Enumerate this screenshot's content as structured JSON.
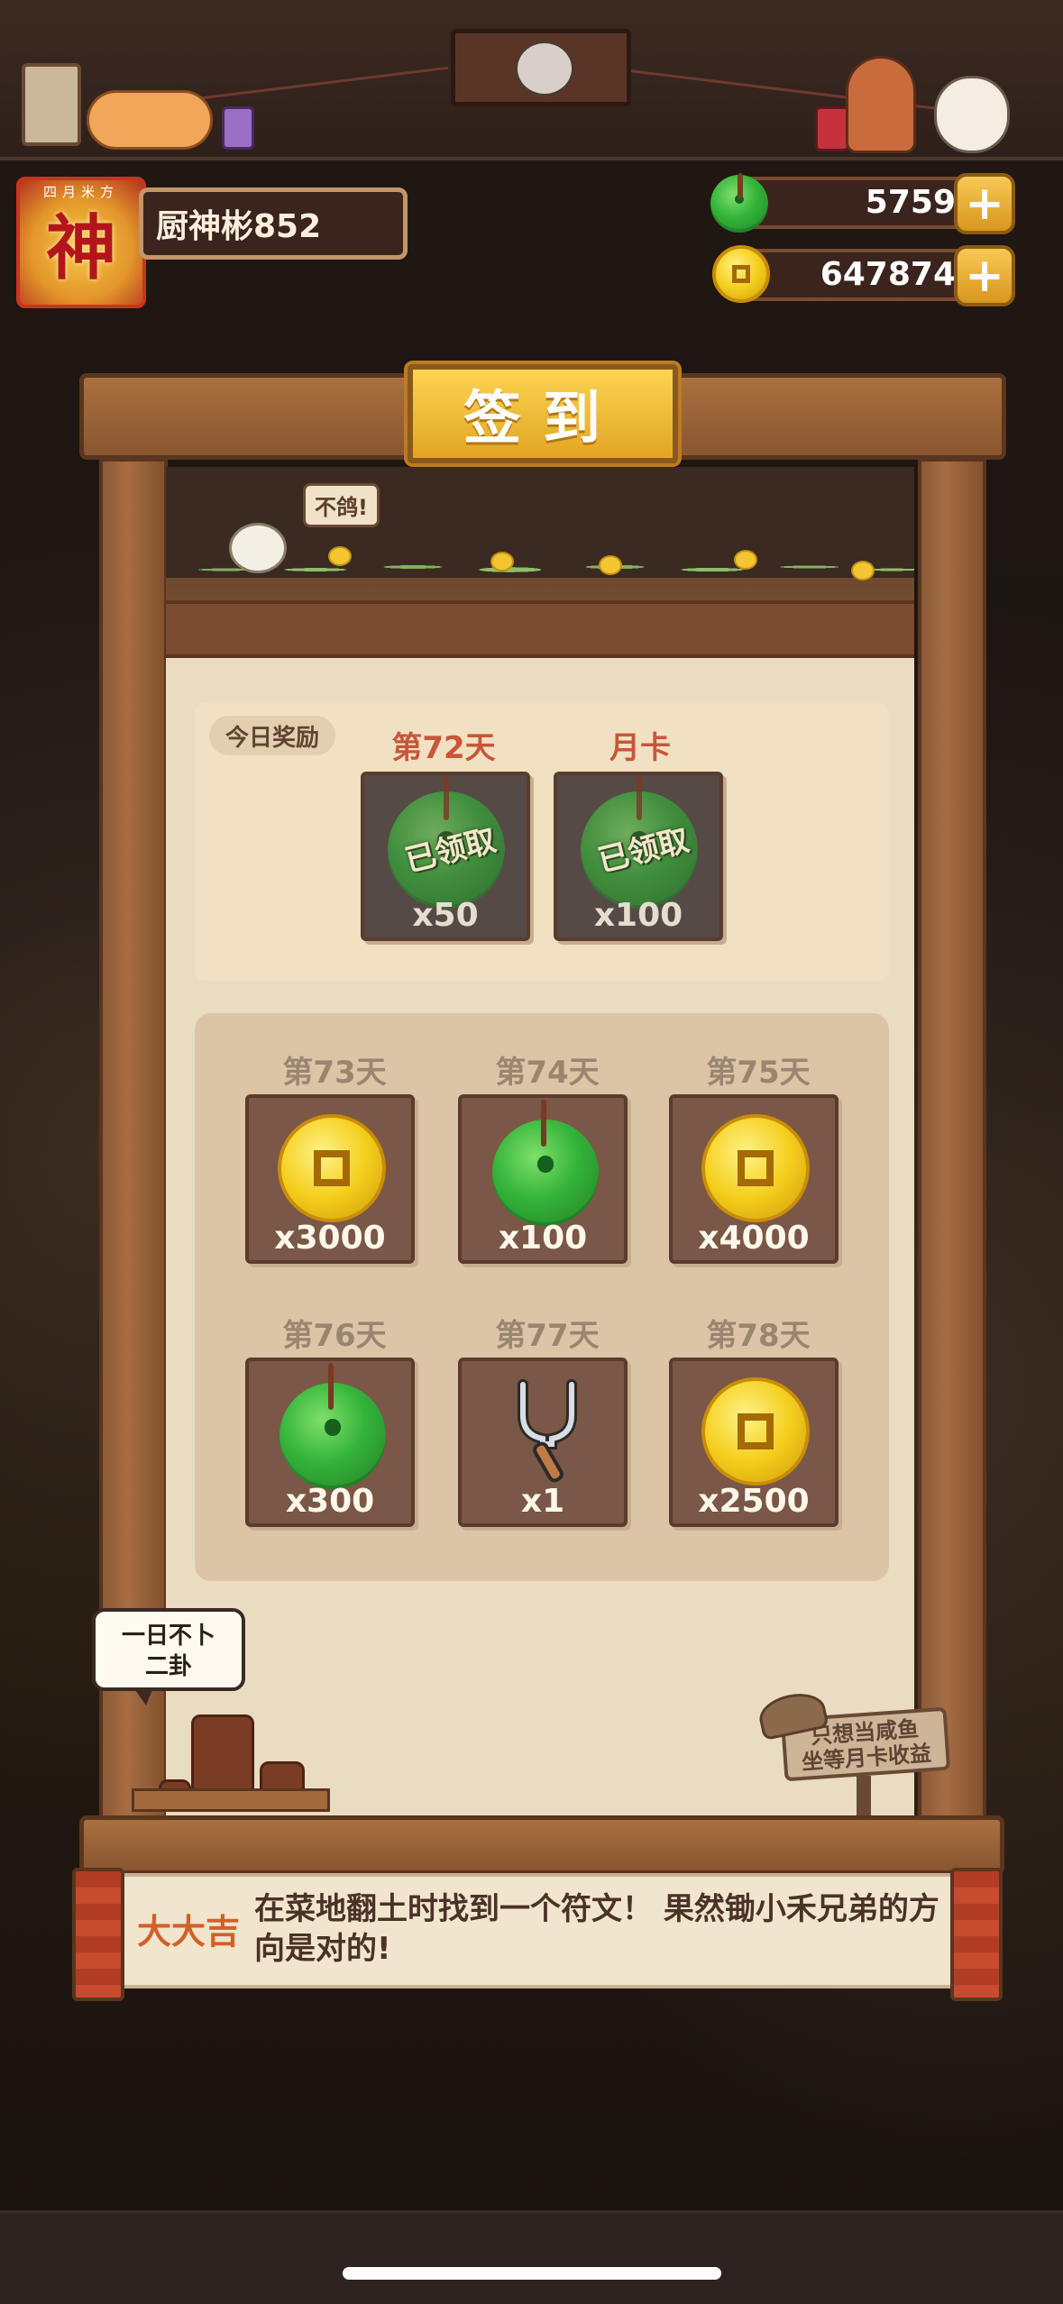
{
  "player": {
    "avatar_char": "神",
    "avatar_top": "四月米方",
    "name": "厨神彬852"
  },
  "currency": {
    "jade": "5759",
    "coins": "647874",
    "plus_symbol": "+"
  },
  "dialog": {
    "title": "签到",
    "bird_speech": "不鸽!",
    "today_tag": "今日奖励",
    "today_rewards": [
      {
        "label": "第72天",
        "item": "jade-icon",
        "quantity": "x50",
        "status": "已领取"
      },
      {
        "label": "月卡",
        "item": "jade-icon",
        "quantity": "x100",
        "status": "已领取"
      }
    ],
    "upcoming_rewards": [
      {
        "label": "第73天",
        "item": "coin-icon",
        "quantity": "x3000"
      },
      {
        "label": "第74天",
        "item": "jade-icon",
        "quantity": "x100"
      },
      {
        "label": "第75天",
        "item": "coin-icon",
        "quantity": "x4000"
      },
      {
        "label": "第76天",
        "item": "jade-icon",
        "quantity": "x300"
      },
      {
        "label": "第77天",
        "item": "fork-icon",
        "quantity": "x1"
      },
      {
        "label": "第78天",
        "item": "coin-icon",
        "quantity": "x2500"
      }
    ],
    "thought_bubble": [
      "一日不卜",
      "二卦"
    ],
    "sign_text": [
      "只想当咸鱼",
      "坐等月卡收益"
    ]
  },
  "fortune": {
    "tag": "大大吉",
    "text": "在菜地翻土时找到一个符文！ 果然锄小禾兄弟的方向是对的!"
  },
  "colors": {
    "accent_gold": "#e2a523",
    "day_label_active": "#c8563a",
    "day_label_future": "#9a8570",
    "fortune_tag": "#d2602a"
  }
}
